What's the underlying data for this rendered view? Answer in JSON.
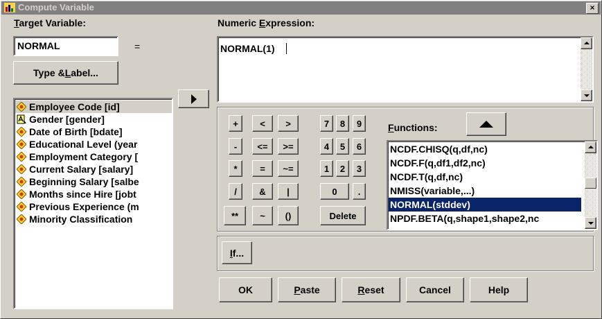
{
  "window": {
    "title": "Compute Variable",
    "close_glyph": "×"
  },
  "target": {
    "label_accel": "T",
    "label_rest": "arget Variable:",
    "value": "NORMAL",
    "equals": "=",
    "type_label_btn_pre": "Type & ",
    "type_label_btn_accel": "L",
    "type_label_btn_rest": "abel..."
  },
  "expression": {
    "label_pre": "Numeric ",
    "label_accel": "E",
    "label_rest": "xpression:",
    "value": "NORMAL(1)"
  },
  "variables": [
    {
      "label": "Employee Code [id]",
      "icon": "numeric-variable-icon",
      "selected": true
    },
    {
      "label": "Gender [gender]",
      "icon": "string-variable-icon"
    },
    {
      "label": "Date of Birth [bdate]",
      "icon": "numeric-variable-icon"
    },
    {
      "label": "Educational Level (year",
      "icon": "numeric-variable-icon"
    },
    {
      "label": "Employment Category [",
      "icon": "numeric-variable-icon"
    },
    {
      "label": "Current Salary [salary]",
      "icon": "numeric-variable-icon"
    },
    {
      "label": "Beginning Salary [salbe",
      "icon": "numeric-variable-icon"
    },
    {
      "label": "Months since Hire [jobt",
      "icon": "numeric-variable-icon"
    },
    {
      "label": "Previous Experience (m",
      "icon": "numeric-variable-icon"
    },
    {
      "label": "Minority Classification",
      "icon": "numeric-variable-icon"
    }
  ],
  "keypad": {
    "r1": [
      "+",
      "<",
      ">",
      "7",
      "8",
      "9"
    ],
    "r2": [
      "-",
      "<=",
      ">=",
      "4",
      "5",
      "6"
    ],
    "r3": [
      "*",
      "=",
      "~=",
      "1",
      "2",
      "3"
    ],
    "r4": [
      "/",
      "&",
      "|",
      "0",
      "."
    ],
    "r5": [
      "**",
      "~",
      "()",
      "Delete"
    ]
  },
  "functions": {
    "label_accel": "F",
    "label_rest": "unctions:",
    "items": [
      "NCDF.CHISQ(q,df,nc)",
      "NCDF.F(q,df1,df2,nc)",
      "NCDF.T(q,df,nc)",
      "NMISS(variable,...)",
      "NORMAL(stddev)",
      "NPDF.BETA(q,shape1,shape2,nc"
    ],
    "selected_index": 4
  },
  "if_btn": {
    "accel": "I",
    "rest": "f..."
  },
  "buttons": {
    "ok": "OK",
    "paste_accel": "P",
    "paste_rest": "aste",
    "reset_accel": "R",
    "reset_rest": "eset",
    "cancel": "Cancel",
    "help": "Help"
  }
}
